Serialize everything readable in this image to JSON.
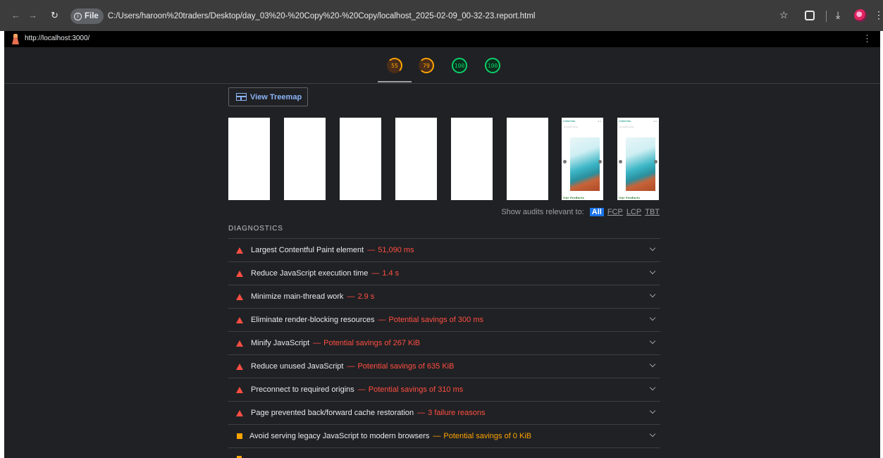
{
  "browser": {
    "file_chip": "File",
    "address": "C:/Users/haroon%20traders/Desktop/day_03%20-%20Copy%20-%20Copy/localhost_2025-02-09_00-32-23.report.html",
    "icons": [
      "back-icon",
      "forward-icon",
      "reload-icon",
      "info-icon",
      "star-icon",
      "extensions-icon",
      "download-icon",
      "profile-icon",
      "menu-icon"
    ]
  },
  "report": {
    "url": "http://localhost:3000/",
    "scores": [
      "55",
      "79",
      "100",
      "100"
    ],
    "treemap_label": "View Treemap",
    "filmstrip": {
      "brand": "FURNITURE",
      "subtitle": "for modern homes",
      "footer": "Our Products"
    },
    "filter": {
      "label": "Show audits relevant to:",
      "options": [
        "All",
        "FCP",
        "LCP",
        "TBT"
      ]
    },
    "diagnostics_title": "DIAGNOSTICS",
    "audits": [
      {
        "title": "Largest Contentful Paint element",
        "value": "51,090 ms",
        "rating": "fail"
      },
      {
        "title": "Reduce JavaScript execution time",
        "value": "1.4 s",
        "rating": "fail"
      },
      {
        "title": "Minimize main-thread work",
        "value": "2.9 s",
        "rating": "fail"
      },
      {
        "title": "Eliminate render-blocking resources",
        "value": "Potential savings of 300 ms",
        "rating": "fail"
      },
      {
        "title": "Minify JavaScript",
        "value": "Potential savings of 267 KiB",
        "rating": "fail"
      },
      {
        "title": "Reduce unused JavaScript",
        "value": "Potential savings of 635 KiB",
        "rating": "fail"
      },
      {
        "title": "Preconnect to required origins",
        "value": "Potential savings of 310 ms",
        "rating": "fail"
      },
      {
        "title": "Page prevented back/forward cache restoration",
        "value": "3 failure reasons",
        "rating": "fail"
      },
      {
        "title": "Avoid serving legacy JavaScript to modern browsers",
        "value": "Potential savings of 0 KiB",
        "rating": "average"
      }
    ],
    "separator": "—",
    "colors": {
      "fail": "#ff4e42",
      "average": "#ffa400",
      "pass": "#0cce6b",
      "accent": "#1a73e8"
    }
  }
}
